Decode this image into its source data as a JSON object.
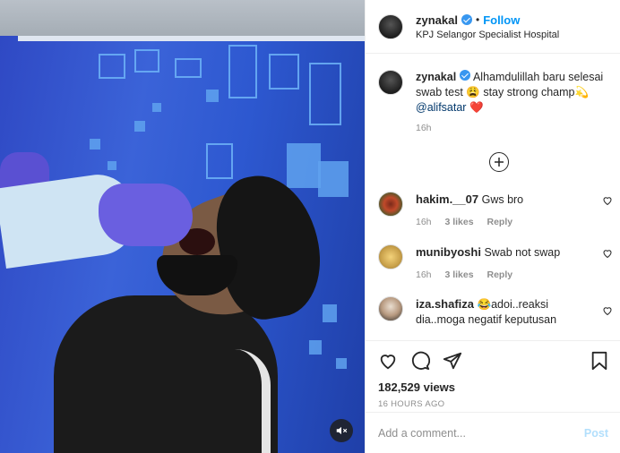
{
  "post": {
    "username": "zynakal",
    "follow_label": "Follow",
    "separator": "•",
    "location": "KPJ Selangor Specialist Hospital"
  },
  "caption": {
    "username": "zynakal",
    "text_1": "Alhamdulillah baru selesai swab test ",
    "emoji_1": "😩",
    "text_2": " stay strong champ",
    "emoji_2": "💫",
    "mention": "@alifsatar",
    "emoji_3": "❤️",
    "time": "16h"
  },
  "comments": [
    {
      "username": "hakim.__07",
      "text": "Gws bro",
      "time": "16h",
      "likes": "3 likes",
      "reply": "Reply"
    },
    {
      "username": "munibyoshi",
      "text": "Swab not swap",
      "time": "16h",
      "likes": "3 likes",
      "reply": "Reply"
    },
    {
      "username": "iza.shafiza",
      "emoji": "😂",
      "text": "adoi..reaksi dia..moga negatif keputusan"
    }
  ],
  "stats": {
    "views": "182,529 views",
    "ago": "16 HOURS AGO"
  },
  "composer": {
    "placeholder": "Add a comment...",
    "post_label": "Post"
  },
  "icons": {
    "mute": "speaker-muted-icon",
    "more": "plus-circle-icon",
    "like": "heart-icon",
    "comment": "comment-bubble-icon",
    "share": "paper-plane-icon",
    "save": "bookmark-icon"
  },
  "colors": {
    "accent": "#0095f6",
    "verified": "#3897f0",
    "muted_text": "#8e8e8e",
    "post_disabled": "#b2dffc"
  }
}
